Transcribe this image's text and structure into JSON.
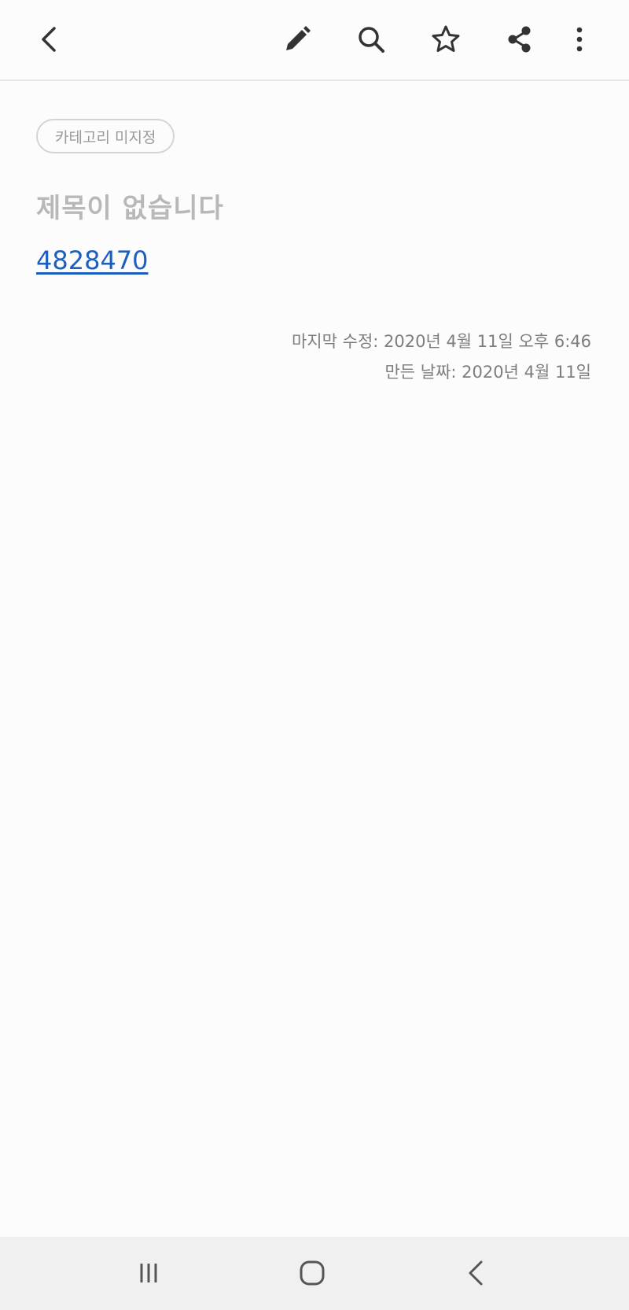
{
  "toolbar": {
    "icons": [
      "back-arrow",
      "pencil-edit",
      "search",
      "star-outline",
      "share",
      "more-vertical"
    ]
  },
  "note": {
    "category": "카테고리 미지정",
    "title": "제목이 없습니다",
    "body_link": "4828470",
    "last_modified": "마지막 수정: 2020년 4월 11일 오후 6:46",
    "created": "만든 날짜: 2020년 4월 11일"
  },
  "navbar": {
    "icons": [
      "recent-apps",
      "home",
      "back"
    ]
  },
  "colors": {
    "background": "#fcfcfc",
    "link": "#1d5fbf",
    "title_placeholder": "#b8b8b8",
    "meta_text": "#7d7d7d",
    "icon": "#333333",
    "navbar_bg": "#f0f0f0"
  }
}
